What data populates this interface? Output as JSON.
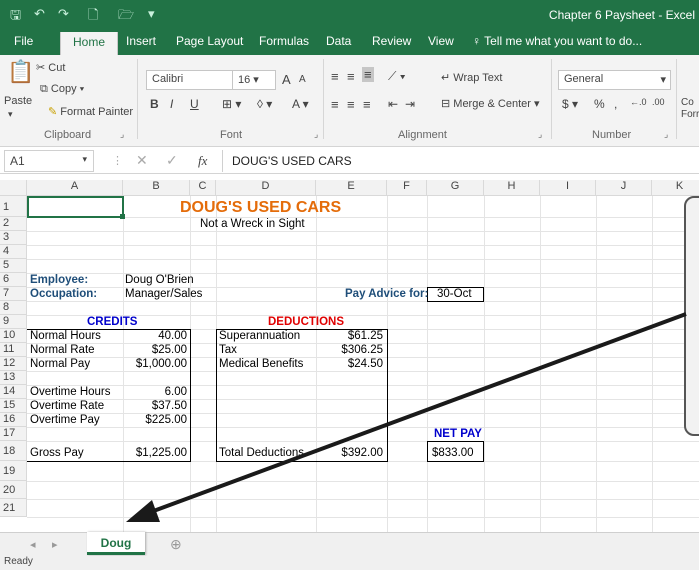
{
  "window": {
    "title": "Chapter 6 Paysheet - Excel"
  },
  "quick_access": {
    "save": "🖫",
    "undo": "↶",
    "redo": "↷",
    "new": "🗋",
    "open": "🗁",
    "customize": "▾"
  },
  "ribbon_tabs": [
    "File",
    "Home",
    "Insert",
    "Page Layout",
    "Formulas",
    "Data",
    "Review",
    "View"
  ],
  "tell_me": "Tell me what you want to do...",
  "clipboard": {
    "paste": "Paste",
    "cut": "Cut",
    "copy": "Copy",
    "format_painter": "Format Painter",
    "group": "Clipboard"
  },
  "font": {
    "name": "Calibri",
    "size": "16",
    "grow": "A",
    "shrink": "A",
    "bold": "B",
    "italic": "I",
    "underline": "U",
    "group": "Font"
  },
  "alignment": {
    "wrap": "Wrap Text",
    "merge": "Merge & Center",
    "group": "Alignment"
  },
  "number": {
    "format": "General",
    "currency": "$",
    "percent": "%",
    "comma": ",",
    "group": "Number",
    "more": "Co",
    "more2": "Forr"
  },
  "formula_bar": {
    "name_box": "A1",
    "fx": "fx",
    "content": "DOUG'S USED CARS"
  },
  "columns": [
    "A",
    "B",
    "C",
    "D",
    "E",
    "F",
    "G",
    "H",
    "I",
    "J",
    "K"
  ],
  "rows": [
    "1",
    "2",
    "3",
    "4",
    "5",
    "6",
    "7",
    "8",
    "9",
    "10",
    "11",
    "12",
    "13",
    "14",
    "15",
    "16",
    "17",
    "18",
    "19",
    "20",
    "21"
  ],
  "sheet": {
    "title": "DOUG'S USED CARS",
    "subtitle": "Not a Wreck in Sight",
    "employee_label": "Employee:",
    "employee": "Doug O'Brien",
    "occupation_label": "Occupation:",
    "occupation": "Manager/Sales",
    "pay_advice_label": "Pay Advice for:",
    "pay_advice_date": "30-Oct",
    "credits_header": "CREDITS",
    "deductions_header": "DEDUCTIONS",
    "credits": [
      {
        "label": "Normal Hours",
        "value": "40.00"
      },
      {
        "label": "Normal Rate",
        "value": "$25.00"
      },
      {
        "label": "Normal Pay",
        "value": "$1,000.00"
      },
      {
        "label": "Overtime Hours",
        "value": "6.00"
      },
      {
        "label": "Overtime Rate",
        "value": "$37.50"
      },
      {
        "label": "Overtime Pay",
        "value": "$225.00"
      },
      {
        "label": "Gross Pay",
        "value": "$1,225.00"
      }
    ],
    "deductions": [
      {
        "label": "Superannuation",
        "value": "$61.25"
      },
      {
        "label": "Tax",
        "value": "$306.25"
      },
      {
        "label": "Medical Benefits",
        "value": "$24.50"
      }
    ],
    "total_deductions_label": "Total Deductions",
    "total_deductions": "$392.00",
    "net_pay_label": "NET PAY",
    "net_pay": "$833.00"
  },
  "sheet_tabs": {
    "active": "Doug",
    "add": "⊕"
  },
  "status": {
    "text": "Ready"
  },
  "colors": {
    "excel_green": "#217346",
    "title_orange": "#e46c0a",
    "label_blue": "#1f4e79",
    "credits_blue": "#0000cc",
    "deductions_red": "#e00000"
  }
}
